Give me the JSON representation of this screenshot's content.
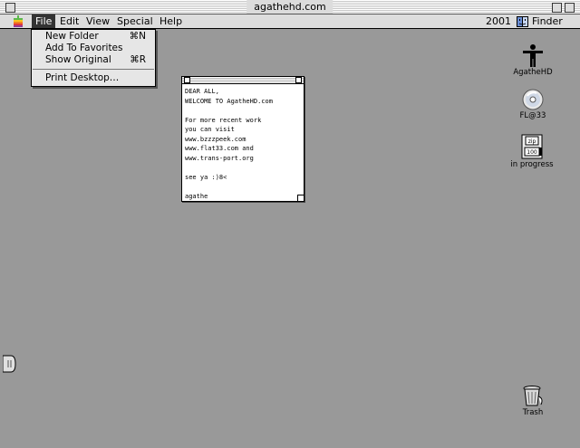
{
  "window": {
    "title": "agathehd.com"
  },
  "menubar": {
    "items": [
      "File",
      "Edit",
      "View",
      "Special",
      "Help"
    ],
    "clock": "2001",
    "app_name": "Finder"
  },
  "dropdown": {
    "items": [
      {
        "label": "New Folder",
        "shortcut": "⌘N"
      },
      {
        "label": "Add To Favorites",
        "shortcut": ""
      },
      {
        "label": "Show Original",
        "shortcut": "⌘R"
      },
      {
        "label": "Print Desktop…",
        "shortcut": ""
      }
    ]
  },
  "note": {
    "text": "DEAR ALL,\nWELCOME TO AgatheHD.com\n\nFor more recent work\nyou can visit\nwww.bzzzpeek.com\nwww.flat33.com and\nwww.trans-port.org\n\nsee ya :)8<\n\nagathe"
  },
  "desktop_icons": [
    {
      "label": "AgatheHD",
      "icon": "figure-icon"
    },
    {
      "label": "FL@33",
      "icon": "cd-icon"
    },
    {
      "label": "in progress",
      "icon": "zip-disk-icon"
    },
    {
      "label": "Trash",
      "icon": "trash-icon"
    }
  ],
  "zip_icon_text": {
    "top": "zip",
    "bottom": "100"
  }
}
